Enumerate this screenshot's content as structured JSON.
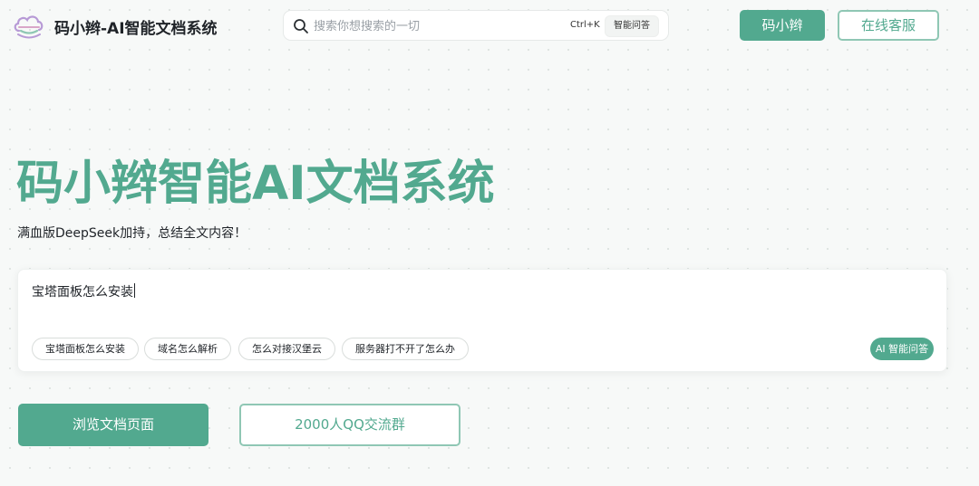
{
  "header": {
    "brand": "码小辫-AI智能文档系统",
    "search": {
      "placeholder": "搜索你想搜索的一切",
      "shortcut": "Ctrl+K",
      "ai_chip": "智能问答"
    },
    "primary_button": "码小辫",
    "secondary_button": "在线客服"
  },
  "hero": {
    "title": "码小辫智能AI文档系统",
    "subtitle": "满血版DeepSeek加持，总结全文内容！"
  },
  "prompt": {
    "value": "宝塔面板怎么安装",
    "suggestions": [
      "宝塔面板怎么安装",
      "域名怎么解析",
      "怎么对接汉堡云",
      "服务器打不开了怎么办"
    ],
    "submit_label": "AI 智能问答"
  },
  "actions": {
    "browse": "浏览文档页面",
    "qq_group": "2000人QQ交流群"
  },
  "colors": {
    "accent": "#52a98f",
    "accent_border": "#8fc7b4",
    "background": "#f7f9f8"
  }
}
